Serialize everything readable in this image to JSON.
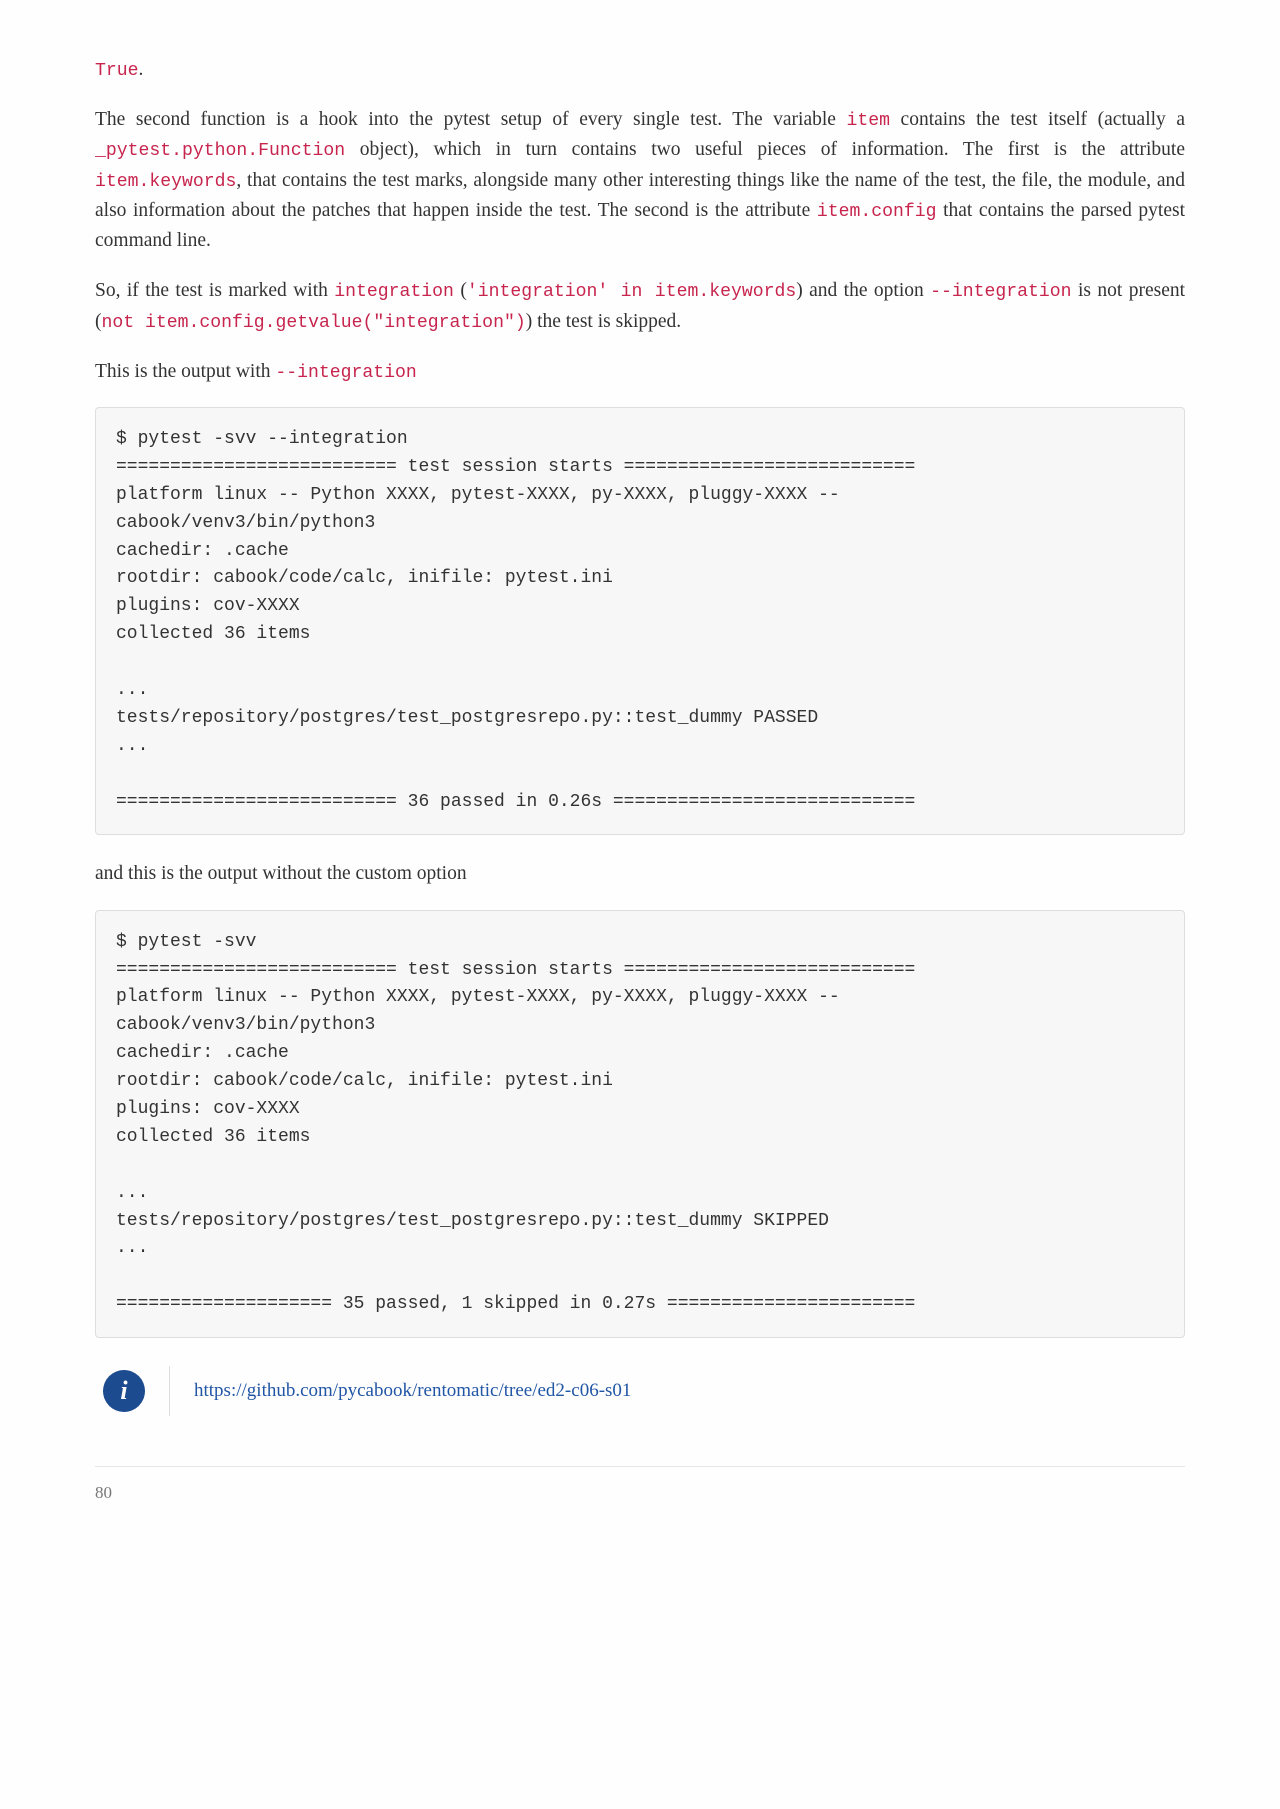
{
  "para0_code": "True",
  "para0_tail": ".",
  "para1": {
    "t1": "The second function is a hook into the pytest setup of every single test. The variable ",
    "c1": "item",
    "t2": " contains the test itself (actually a ",
    "c2": "_pytest.python.Function",
    "t3": " object), which in turn contains two useful pieces of information. The first is the attribute ",
    "c3": "item.keywords",
    "t4": ", that contains the test marks, alongside many other interesting things like the name of the test, the file, the module, and also information about the patches that happen inside the test. The second is the attribute ",
    "c4": "item.config",
    "t5": " that contains the parsed pytest command line."
  },
  "para2": {
    "t1": "So, if the test is marked with ",
    "c1": "integration",
    "t2": " (",
    "c2": "'integration' in item.keywords",
    "t3": ") and the option ",
    "c3": "--integration",
    "t4": " is not present (",
    "c4": "not item.config.getvalue(\"integration\")",
    "t5": ") the test is skipped."
  },
  "para3": {
    "t1": "This is the output with ",
    "c1": "--integration"
  },
  "codeblock1": "$ pytest -svv --integration\n========================== test session starts ===========================\nplatform linux -- Python XXXX, pytest-XXXX, py-XXXX, pluggy-XXXX --\ncabook/venv3/bin/python3\ncachedir: .cache\nrootdir: cabook/code/calc, inifile: pytest.ini\nplugins: cov-XXXX\ncollected 36 items\n\n...\ntests/repository/postgres/test_postgresrepo.py::test_dummy PASSED\n...\n\n========================== 36 passed in 0.26s ============================",
  "para4": "and this is the output without the custom option",
  "codeblock2": "$ pytest -svv\n========================== test session starts ===========================\nplatform linux -- Python XXXX, pytest-XXXX, py-XXXX, pluggy-XXXX --\ncabook/venv3/bin/python3\ncachedir: .cache\nrootdir: cabook/code/calc, inifile: pytest.ini\nplugins: cov-XXXX\ncollected 36 items\n\n...\ntests/repository/postgres/test_postgresrepo.py::test_dummy SKIPPED\n...\n\n==================== 35 passed, 1 skipped in 0.27s =======================",
  "info_icon_label": "i",
  "info_link": "https://github.com/pycabook/rentomatic/tree/ed2-c06-s01",
  "page_number": "80"
}
